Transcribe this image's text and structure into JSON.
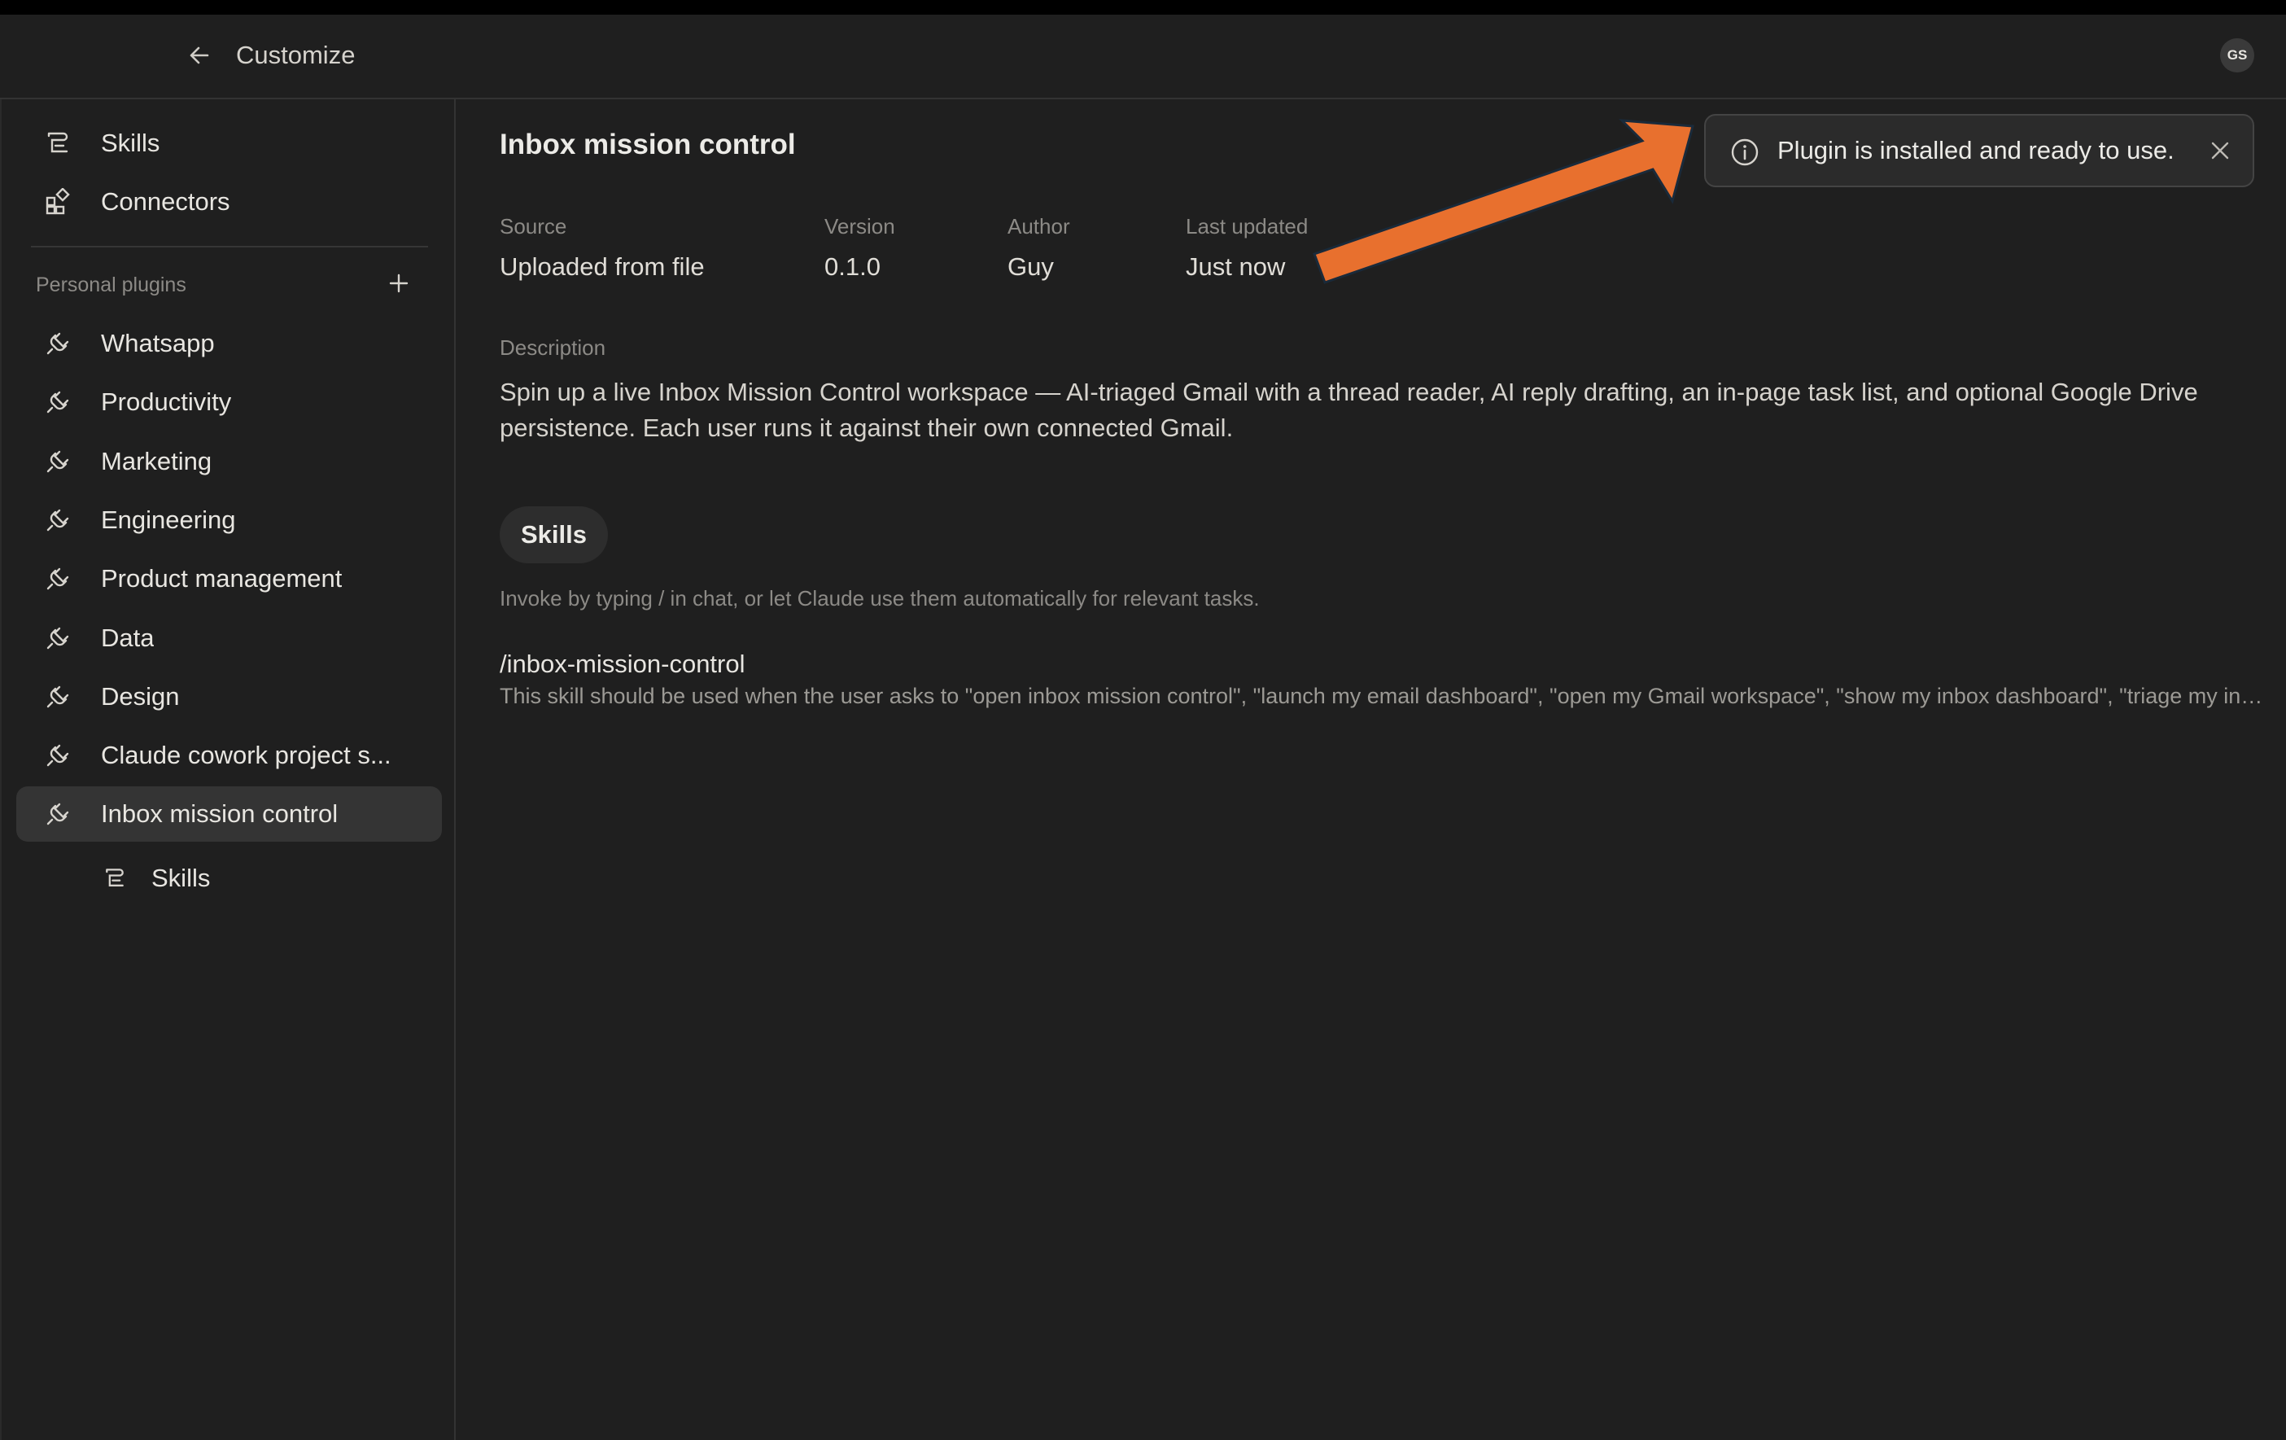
{
  "header": {
    "title": "Customize",
    "avatar_initials": "GS"
  },
  "sidebar": {
    "top_items": [
      {
        "label": "Skills",
        "icon": "skills-icon"
      },
      {
        "label": "Connectors",
        "icon": "connectors-icon"
      }
    ],
    "section_label": "Personal plugins",
    "plugins": [
      {
        "label": "Whatsapp",
        "icon": "plug-icon"
      },
      {
        "label": "Productivity",
        "icon": "plug-icon"
      },
      {
        "label": "Marketing",
        "icon": "plug-icon"
      },
      {
        "label": "Engineering",
        "icon": "plug-icon"
      },
      {
        "label": "Product management",
        "icon": "plug-icon"
      },
      {
        "label": "Data",
        "icon": "plug-icon"
      },
      {
        "label": "Design",
        "icon": "plug-icon"
      },
      {
        "label": "Claude cowork project s...",
        "icon": "plug-icon"
      },
      {
        "label": "Inbox mission control",
        "icon": "plug-icon",
        "active": true
      }
    ],
    "sub_items": [
      {
        "label": "Skills",
        "icon": "skills-icon"
      }
    ]
  },
  "main": {
    "title": "Inbox mission control",
    "meta": [
      {
        "label": "Source",
        "value": "Uploaded from file"
      },
      {
        "label": "Version",
        "value": "0.1.0"
      },
      {
        "label": "Author",
        "value": "Guy"
      },
      {
        "label": "Last updated",
        "value": "Just now"
      }
    ],
    "description_label": "Description",
    "description": "Spin up a live Inbox Mission Control workspace — AI-triaged Gmail with a thread reader, AI reply drafting, an in-page task list, and optional Google Drive persistence. Each user runs it against their own connected Gmail.",
    "skills_tab": "Skills",
    "invoke_hint": "Invoke by typing / in chat, or let Claude use them automatically for relevant tasks.",
    "skill": {
      "command": "/inbox-mission-control",
      "description": "This skill should be used when the user asks to \"open inbox mission control\", \"launch my email dashboard\", \"open my Gmail workspace\", \"show my inbox dashboard\", \"triage my inbox\", \"open my email command center\""
    }
  },
  "toast": {
    "message": "Plugin is installed and ready to use."
  },
  "colors": {
    "background": "#1f1f1f",
    "active_item": "#343434",
    "annotation_arrow": "#e8702e"
  }
}
